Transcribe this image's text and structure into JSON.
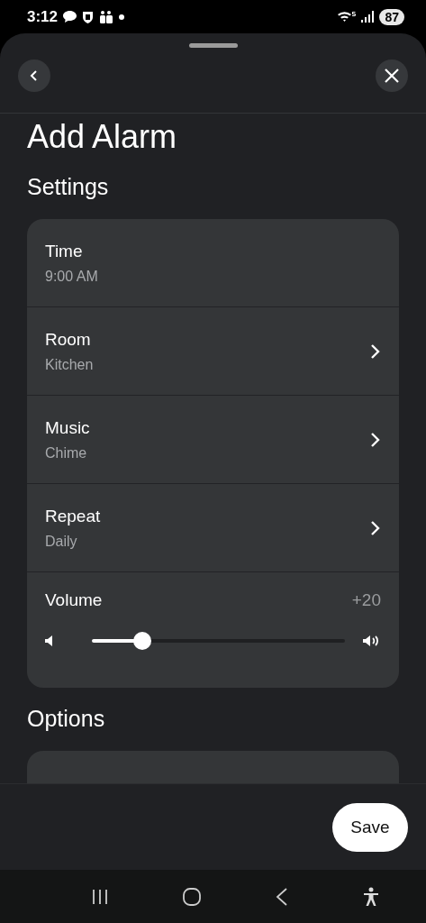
{
  "status_bar": {
    "time": "3:12",
    "battery": "87"
  },
  "header": {
    "title": "Add Alarm"
  },
  "settings": {
    "heading": "Settings",
    "rows": [
      {
        "kind": "value",
        "label": "Time",
        "value": "9:00 AM"
      },
      {
        "kind": "link",
        "label": "Room",
        "value": "Kitchen"
      },
      {
        "kind": "link",
        "label": "Music",
        "value": "Chime"
      },
      {
        "kind": "link",
        "label": "Repeat",
        "value": "Daily"
      },
      {
        "kind": "slider",
        "label": "Volume",
        "value": "+20",
        "level": 0.2
      }
    ]
  },
  "options": {
    "heading": "Options"
  },
  "footer": {
    "save": "Save"
  }
}
